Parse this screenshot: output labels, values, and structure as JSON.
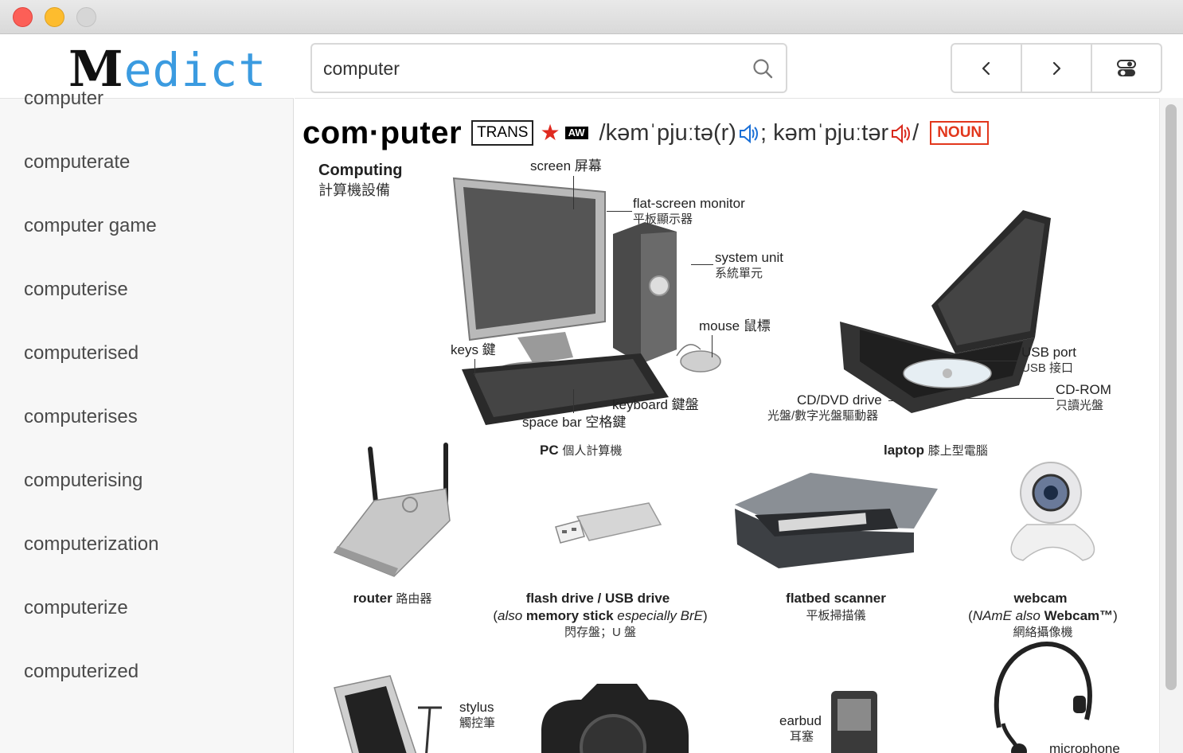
{
  "window": {
    "title": ""
  },
  "app": {
    "logo_first": "M",
    "logo_rest": "edict"
  },
  "search": {
    "value": "computer",
    "placeholder": ""
  },
  "sidebar": {
    "items": [
      {
        "label": "computer"
      },
      {
        "label": "computerate"
      },
      {
        "label": "computer game"
      },
      {
        "label": "computerise"
      },
      {
        "label": "computerised"
      },
      {
        "label": "computerises"
      },
      {
        "label": "computerising"
      },
      {
        "label": "computerization"
      },
      {
        "label": "computerize"
      },
      {
        "label": "computerized"
      }
    ]
  },
  "nav": {
    "back_icon": "chevron-left-icon",
    "forward_icon": "chevron-right-icon",
    "settings_icon": "toggle-icon"
  },
  "entry": {
    "headword": "com·puter",
    "trans_label": "TRANS",
    "aw_label": "AW",
    "pron_br": "/kəmˈpjuːtə(r)",
    "pron_sep": "; ",
    "pron_us": "kəmˈpjuːtər",
    "pron_end": "/",
    "pos": "NOUN",
    "pron_br_color": "#1a6fd6",
    "pron_us_color": "#d9281c"
  },
  "illustration": {
    "section_title": "Computing",
    "section_title_cjk": "計算機設備",
    "labels": {
      "screen": "screen 屏幕",
      "monitor": "flat-screen monitor",
      "monitor_cjk": "平板顯示器",
      "system_unit": "system unit",
      "system_unit_cjk": "系統單元",
      "mouse": "mouse 鼠標",
      "keys": "keys 鍵",
      "keyboard": "keyboard 鍵盤",
      "space_bar": "space bar 空格鍵",
      "pc": "PC",
      "pc_cjk": "個人計算機",
      "laptop": "laptop",
      "laptop_cjk": "膝上型電腦",
      "usb_port": "USB port",
      "usb_port_cjk": "USB 接口",
      "cd_rom": "CD-ROM",
      "cd_rom_cjk": "只讀光盤",
      "cd_dvd": "CD/DVD drive",
      "cd_dvd_cjk": "光盤/數字光盤驅動器",
      "router": "router",
      "router_cjk": "路由器",
      "flash_drive": "flash drive / USB drive",
      "flash_drive_note_1": "(",
      "flash_drive_also": "also",
      "flash_drive_memory": " memory stick ",
      "flash_drive_especially": "especially BrE",
      "flash_drive_note_2": ")",
      "flash_drive_cjk": "閃存盤；U 盤",
      "scanner": "flatbed scanner",
      "scanner_cjk": "平板掃描儀",
      "webcam": "webcam",
      "webcam_note_1": "(",
      "webcam_name": "NAmE also",
      "webcam_brand": " Webcam™",
      "webcam_note_2": ")",
      "webcam_cjk": "網絡攝像機",
      "stylus": "stylus",
      "stylus_cjk": "觸控筆",
      "earbud": "earbud",
      "earbud_cjk": "耳塞",
      "microphone": "microphone"
    }
  }
}
